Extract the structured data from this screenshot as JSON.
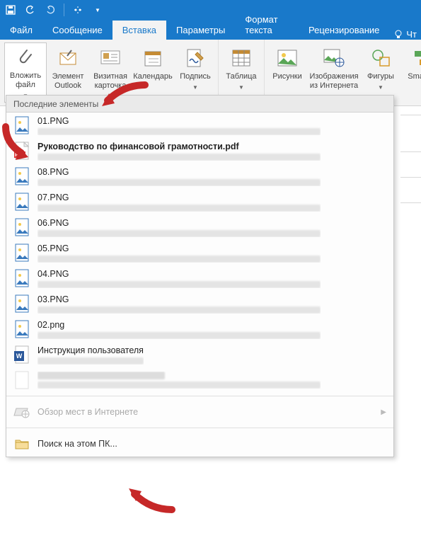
{
  "qat": {
    "save": "save",
    "undo": "undo",
    "redo": "redo"
  },
  "tabs": {
    "file": "Файл",
    "message": "Сообщение",
    "insert": "Вставка",
    "options": "Параметры",
    "format": "Формат текста",
    "review": "Рецензирование",
    "reading": "Чт"
  },
  "ribbon": {
    "attach_file": "Вложить\nфайл",
    "outlook_item": "Элемент\nOutlook",
    "biz_card": "Визитная\nкарточка",
    "calendar": "Календарь",
    "signature": "Подпись",
    "table": "Таблица",
    "pictures": "Рисунки",
    "online_pictures": "Изображения\nиз Интернета",
    "shapes": "Фигуры",
    "smartart": "SmartArt"
  },
  "panel": {
    "header": "Последние элементы",
    "items": [
      {
        "name": "01.PNG",
        "type": "img"
      },
      {
        "name": "Руководство по финансовой грамотности.pdf",
        "type": "pdf",
        "bold": true
      },
      {
        "name": "08.PNG",
        "type": "img"
      },
      {
        "name": "07.PNG",
        "type": "img"
      },
      {
        "name": "06.PNG",
        "type": "img"
      },
      {
        "name": "05.PNG",
        "type": "img"
      },
      {
        "name": "04.PNG",
        "type": "img"
      },
      {
        "name": "03.PNG",
        "type": "img"
      },
      {
        "name": "02.png",
        "type": "img"
      },
      {
        "name": "Инструкция пользователя",
        "type": "doc",
        "pathShort": true
      },
      {
        "name": "",
        "type": "none",
        "blurName": true
      }
    ],
    "browse_web": "Обзор мест в Интернете",
    "browse_pc": "Поиск на этом ПК..."
  }
}
